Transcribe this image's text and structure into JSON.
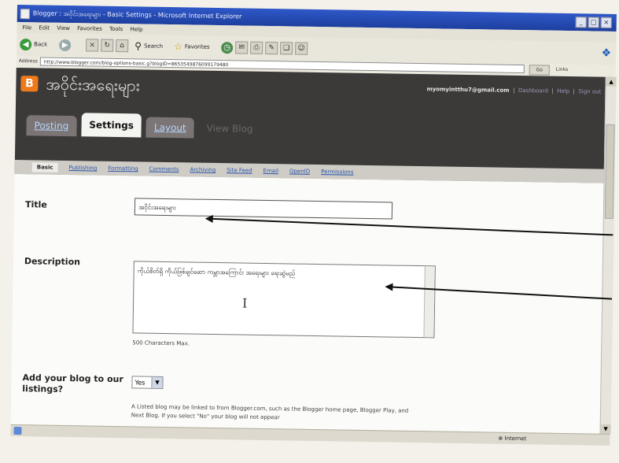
{
  "window": {
    "title": "Blogger : အဝိုင်းအရေးများ - Basic Settings - Microsoft Internet Explorer"
  },
  "menu": [
    "File",
    "Edit",
    "View",
    "Favorites",
    "Tools",
    "Help"
  ],
  "toolbar": {
    "back_label": "Back",
    "search_label": "Search",
    "favorites_label": "Favorites"
  },
  "address": {
    "label": "Address",
    "url": "http://www.blogger.com/blog-options-basic.g?blogID=8653549876099179480",
    "go_label": "Go",
    "links_label": "Links"
  },
  "blog": {
    "name": "အဝိုင်းအရေးများ",
    "user_email": "myomyintthu7@gmail.com",
    "dashboard_label": "Dashboard",
    "help_label": "Help",
    "signout_label": "Sign out",
    "separator": "|"
  },
  "tabs": [
    {
      "label": "Posting",
      "active": false
    },
    {
      "label": "Settings",
      "active": true
    },
    {
      "label": "Layout",
      "active": false
    },
    {
      "label": "View Blog",
      "active": false
    }
  ],
  "subtabs": [
    {
      "label": "Basic",
      "active": true
    },
    {
      "label": "Publishing"
    },
    {
      "label": "Formatting"
    },
    {
      "label": "Comments"
    },
    {
      "label": "Archiving"
    },
    {
      "label": "Site Feed"
    },
    {
      "label": "Email"
    },
    {
      "label": "OpenID"
    },
    {
      "label": "Permissions"
    }
  ],
  "form": {
    "title_label": "Title",
    "title_value": "အဝိုင်းအရေးများ",
    "description_label": "Description",
    "description_value": "ကိုယ်စိတ်ရှိ ကိုယ်ဖြစ်ချင်ဆော ကမ္ဘာအကြောင်း အရေးများ ရေးဆွဲမည်",
    "description_helper": "500 Characters Max.",
    "listing_label_line1": "Add your blog to our",
    "listing_label_line2": "listings?",
    "listing_value": "Yes",
    "listing_description": "A Listed blog may be linked to from Blogger.com, such as the Blogger home page, Blogger Play, and Next Blog. If you select \"No\" your blog will not appear"
  },
  "status": {
    "zone": "Internet"
  },
  "colors": {
    "header_bg": "#3c3a39",
    "blogger_orange": "#ee7a1b",
    "link_blue": "#2a56aa"
  }
}
